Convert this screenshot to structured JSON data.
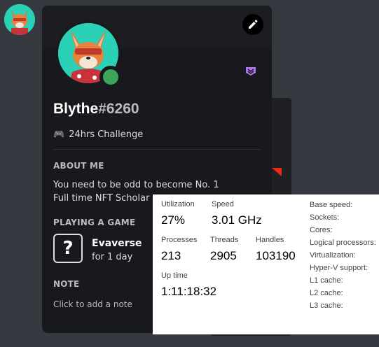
{
  "profile": {
    "username": "Blythe",
    "discriminator": "#6260",
    "custom_status": "24hrs Challenge",
    "status_emoji": "🎮"
  },
  "about": {
    "title": "ABOUT ME",
    "lines": [
      "You need to be odd to become No. 1",
      "Full time NFT Scholar"
    ]
  },
  "activity": {
    "title": "PLAYING A GAME",
    "game_icon": "?",
    "game": "Evaverse",
    "time": "for 1 day"
  },
  "note": {
    "title": "NOTE",
    "placeholder": "Click to add a note"
  },
  "task_manager": {
    "utilization_label": "Utilization",
    "utilization": "27%",
    "speed_label": "Speed",
    "speed": "3.01 GHz",
    "processes_label": "Processes",
    "processes": "213",
    "threads_label": "Threads",
    "threads": "2905",
    "handles_label": "Handles",
    "handles": "103190",
    "uptime_label": "Up time",
    "uptime": "1:11:18:32",
    "details": [
      "Base speed:",
      "Sockets:",
      "Cores:",
      "Logical processors:",
      "Virtualization:",
      "Hyper-V support:",
      "L1 cache:",
      "L2 cache:",
      "L3 cache:"
    ]
  },
  "colors": {
    "online": "#3ba55c",
    "nitro": "#b473f5",
    "avatar_bg": "#2bd1b6"
  }
}
